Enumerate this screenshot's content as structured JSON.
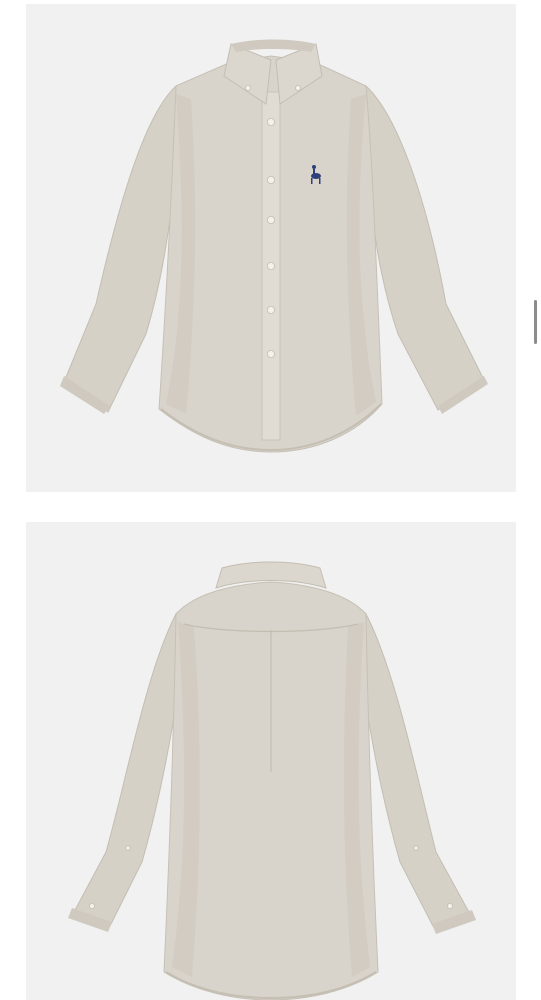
{
  "colors": {
    "background": "#ffffff",
    "panel": "#f1f1f1",
    "shirt": "#d9d4cb",
    "shirt_shadow": "#c9c3b8",
    "shirt_highlight": "#e3dfd7",
    "logo": "#2f3f7a",
    "button": "#f3f1ec"
  },
  "images": [
    {
      "subject": "shirt-front-photo"
    },
    {
      "subject": "shirt-back-photo"
    }
  ]
}
